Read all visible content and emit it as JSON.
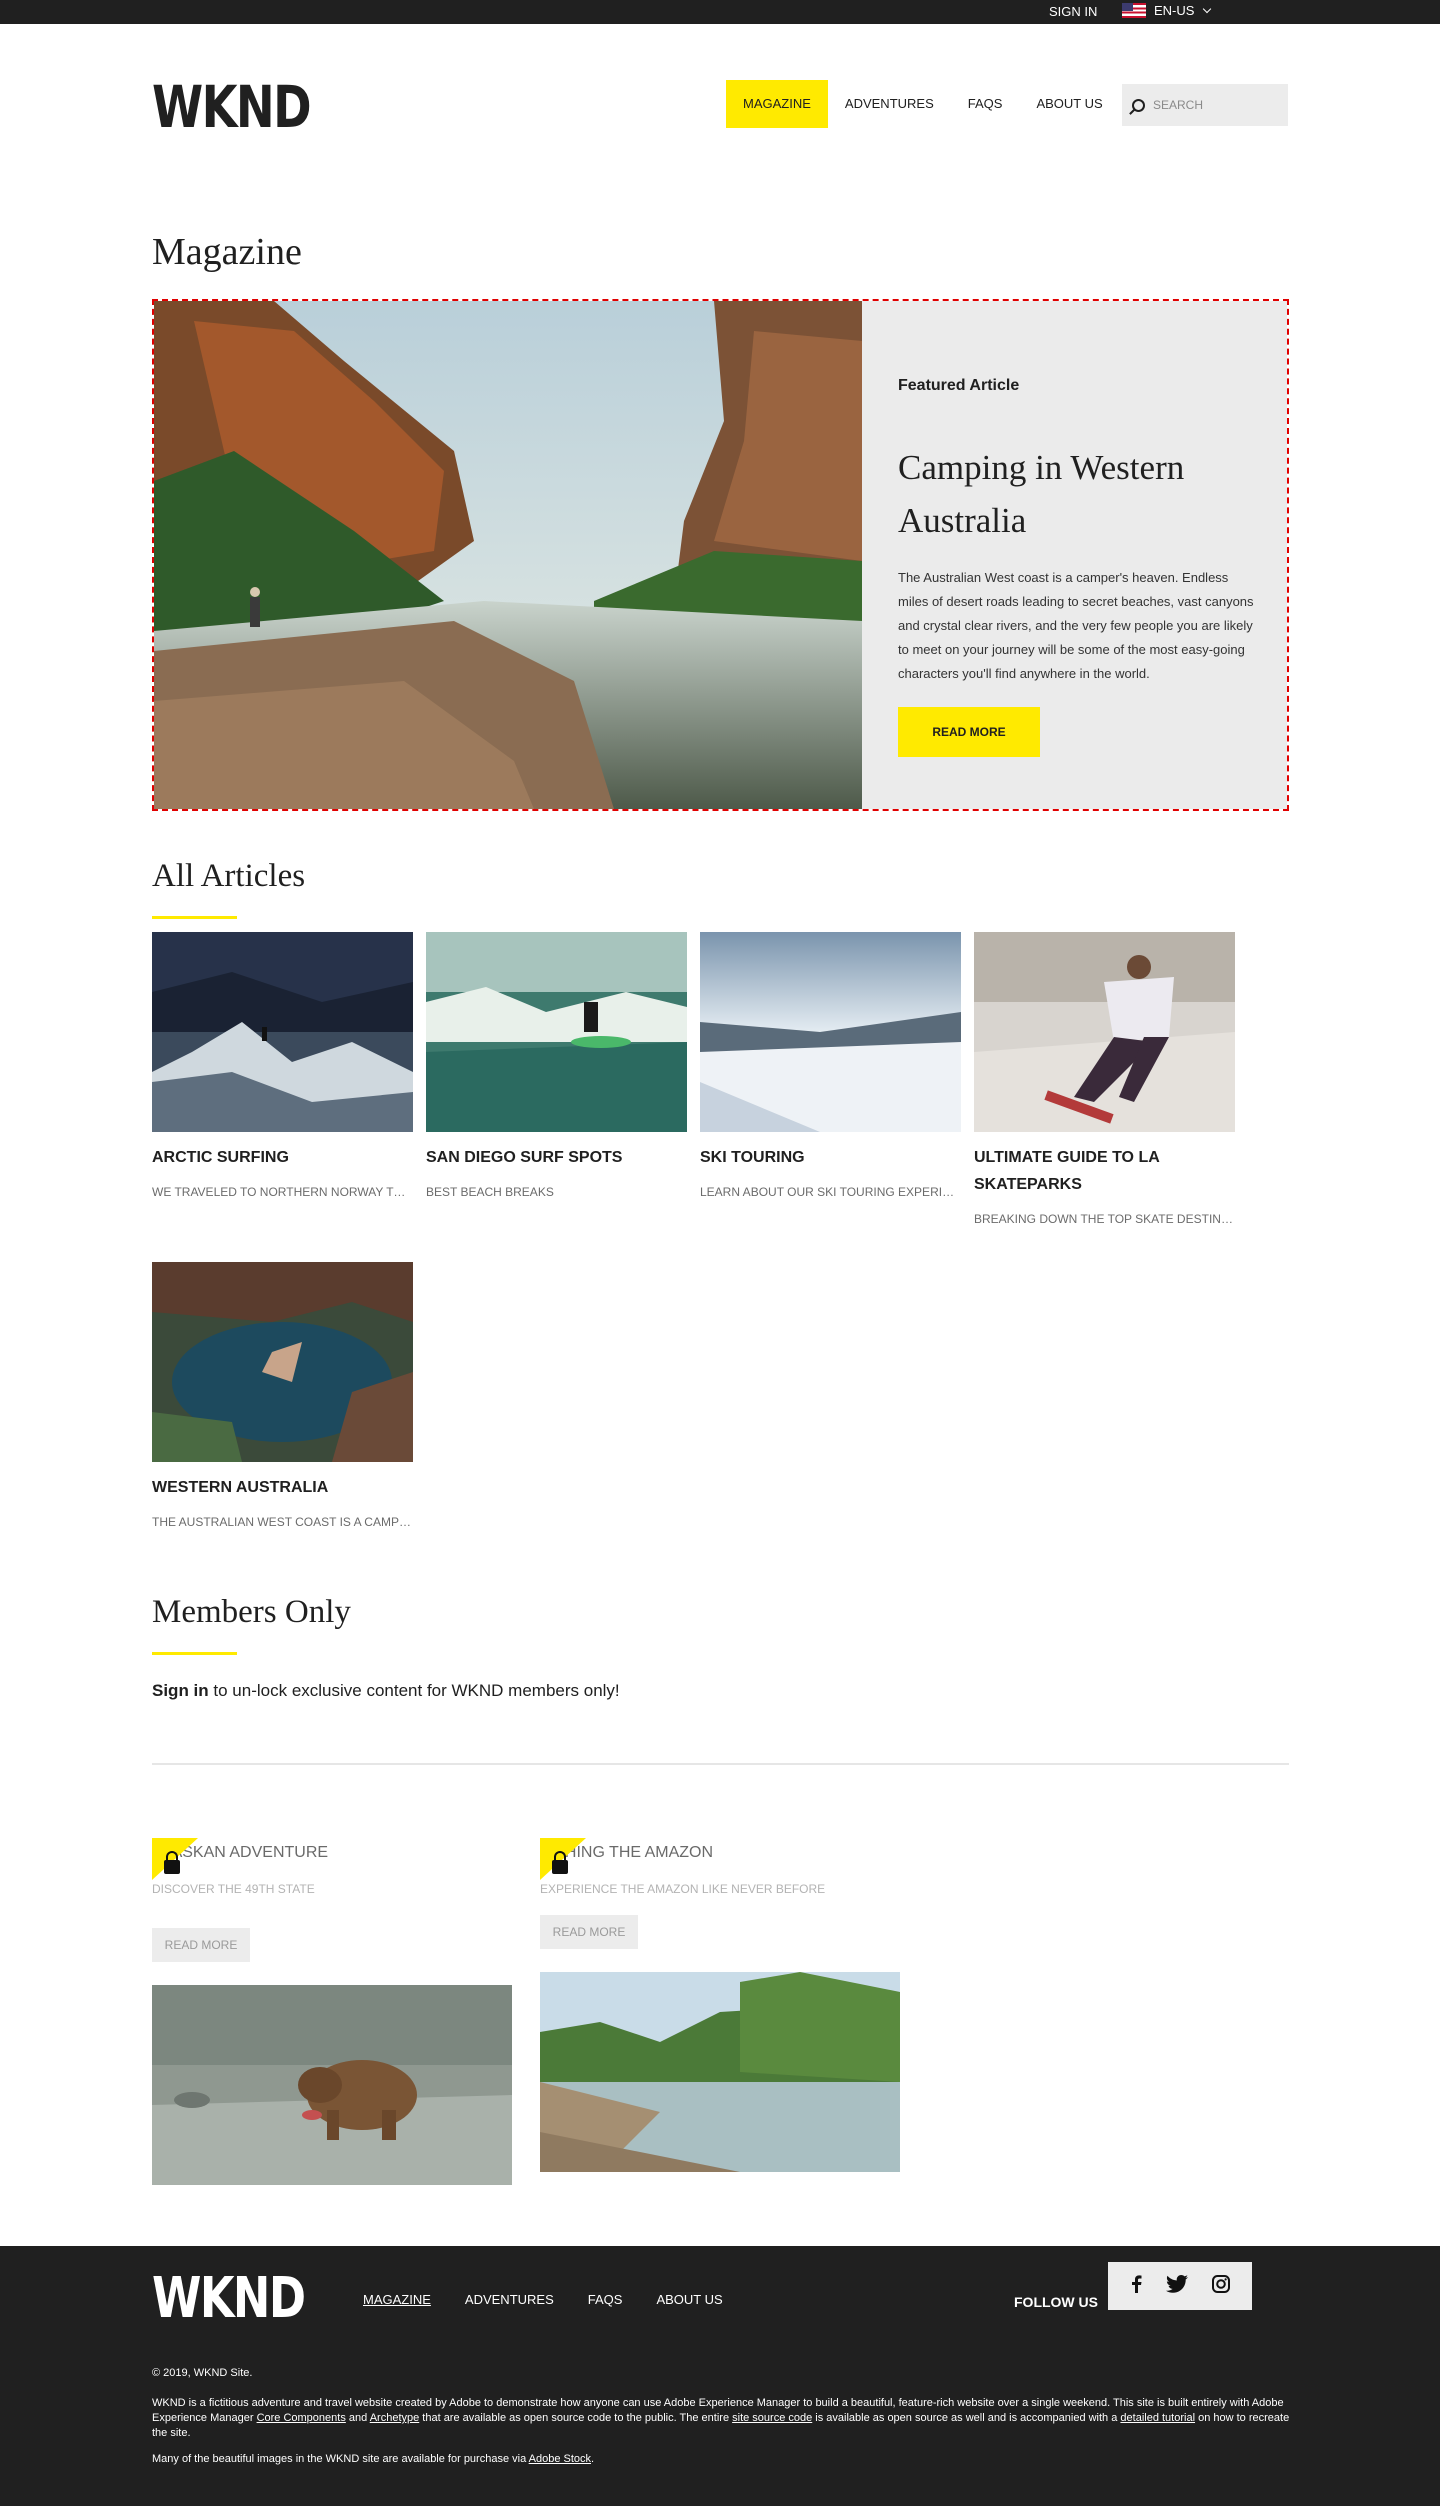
{
  "topbar": {
    "signin": "SIGN IN",
    "language": "EN-US"
  },
  "header": {
    "logo": "WKND",
    "nav": [
      "MAGAZINE",
      "ADVENTURES",
      "FAQS",
      "ABOUT US"
    ],
    "search_placeholder": "SEARCH"
  },
  "page": {
    "title": "Magazine"
  },
  "hero": {
    "kicker": "Featured Article",
    "title": "Camping in Western Australia",
    "description": "The Australian West coast is a camper's heaven. Endless miles of desert roads leading to secret beaches, vast canyons and crystal clear rivers, and the very few people you are likely to meet on your journey will be some of the most easy-going characters you'll find anywhere in the world.",
    "button": "READ MORE"
  },
  "articles": {
    "heading": "All Articles",
    "items": [
      {
        "title": "Arctic Surfing",
        "desc": "WE TRAVELED TO NORTHERN NORWAY TO SURF THE ARCTIC"
      },
      {
        "title": "San Diego Surf Spots",
        "desc": "BEST BEACH BREAKS"
      },
      {
        "title": "Ski Touring",
        "desc": "LEARN ABOUT OUR SKI TOURING EXPERIENCE"
      },
      {
        "title": "Ultimate Guide to LA Skateparks",
        "desc": "BREAKING DOWN THE TOP SKATE DESTINATIONS"
      },
      {
        "title": "Western Australia",
        "desc": "THE AUSTRALIAN WEST COAST IS A CAMPER'S HEAVEN"
      }
    ]
  },
  "members": {
    "heading": "Members Only",
    "signin_link": "Sign in",
    "text": " to un-lock exclusive content for WKND members only!",
    "items": [
      {
        "title": "Alaskan Adventure",
        "desc": "DISCOVER THE 49TH STATE",
        "button": "READ MORE"
      },
      {
        "title": "Fishing the Amazon",
        "desc": "EXPERIENCE THE AMAZON LIKE NEVER BEFORE",
        "button": "READ MORE"
      }
    ]
  },
  "footer": {
    "logo": "WKND",
    "nav": [
      "MAGAZINE",
      "ADVENTURES",
      "FAQS",
      "ABOUT US"
    ],
    "follow": "FOLLOW US",
    "copyright": "© 2019,  WKND Site.",
    "legal_1": "WKND is a fictitious adventure and travel website created by Adobe to demonstrate how anyone can use Adobe Experience Manager to build a beautiful, feature-rich website over a single weekend. This site is built entirely with Adobe Experience Manager ",
    "link_core": "Core Components",
    "legal_2": " and ",
    "link_archetype": "Archetype",
    "legal_3": " that are available as open source code to the public. The entire ",
    "link_source": "site source code",
    "legal_4": " is available as open source as well and is accompanied with a ",
    "link_tutorial": "detailed tutorial",
    "legal_5": " on how to recreate the site.",
    "stock_text": "Many of the beautiful images in the WKND site are available for purchase via ",
    "stock_link": "Adobe Stock",
    "stock_end": "."
  },
  "colors": {
    "accent": "#ffea00",
    "dark": "#202020",
    "panel": "#ebebeb"
  }
}
